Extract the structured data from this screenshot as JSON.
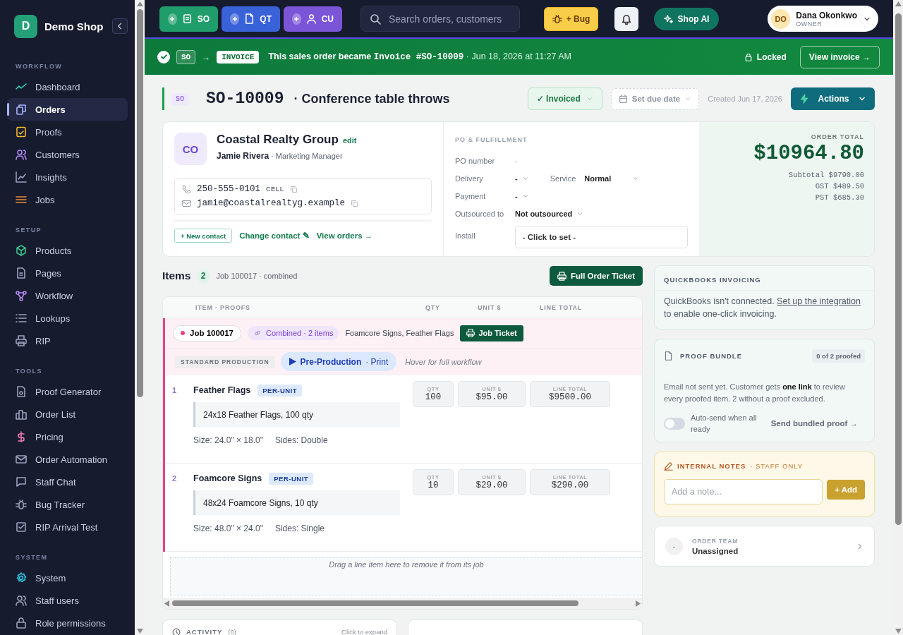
{
  "sidebar": {
    "logo_letter": "D",
    "brand": "Demo Shop",
    "sections": [
      {
        "title": "WORKFLOW",
        "items": [
          {
            "label": "Dashboard",
            "selected": false
          },
          {
            "label": "Orders",
            "selected": true
          },
          {
            "label": "Proofs",
            "selected": false
          },
          {
            "label": "Customers",
            "selected": false
          },
          {
            "label": "Insights",
            "selected": false
          },
          {
            "label": "Jobs",
            "selected": false
          }
        ]
      },
      {
        "title": "SETUP",
        "items": [
          {
            "label": "Products",
            "selected": false
          },
          {
            "label": "Pages",
            "selected": false
          },
          {
            "label": "Workflow",
            "selected": false
          },
          {
            "label": "Lookups",
            "selected": false
          },
          {
            "label": "RIP",
            "selected": false
          }
        ]
      },
      {
        "title": "TOOLS",
        "items": [
          {
            "label": "Proof Generator",
            "selected": false
          },
          {
            "label": "Order List",
            "selected": false
          },
          {
            "label": "Pricing",
            "selected": false
          },
          {
            "label": "Order Automation",
            "selected": false
          },
          {
            "label": "Staff Chat",
            "selected": false
          },
          {
            "label": "Bug Tracker",
            "selected": false
          },
          {
            "label": "RIP Arrival Test",
            "selected": false
          }
        ]
      },
      {
        "title": "SYSTEM",
        "items": [
          {
            "label": "System",
            "selected": false
          },
          {
            "label": "Staff users",
            "selected": false
          },
          {
            "label": "Role permissions",
            "selected": false
          }
        ]
      }
    ]
  },
  "topbar": {
    "quick_create": [
      {
        "label": "SO",
        "color": "#1f9d6a"
      },
      {
        "label": "QT",
        "color": "#3a62d8"
      },
      {
        "label": "CU",
        "color": "#7b55d8"
      }
    ],
    "search": {
      "placeholder": "Search orders, customers"
    },
    "bug_button": "+ Bug",
    "ai_button": "Shop AI",
    "user": {
      "initials": "DO",
      "name": "Dana Okonkwo",
      "role": "OWNER"
    }
  },
  "banner": {
    "from": "SO",
    "arrow": "→",
    "to": "INVOICE",
    "message_start": "This sales order became ",
    "invoice_ref": "Invoice #SO-10009",
    "message_end": " · Jun 18, 2026 at 11:27 AM",
    "locked": "Locked",
    "button": "View invoice →"
  },
  "header": {
    "badge": "SO",
    "number": "SO-10009",
    "title": "· Conference table throws",
    "status": "✓ Invoiced",
    "due_date": "Set due date",
    "created": "Created Jun 17, 2026",
    "actions": "Actions"
  },
  "customer": {
    "initials": "CO",
    "name": "Coastal Realty Group",
    "edit": "edit",
    "contact_name": "Jamie Rivera",
    "contact_role": "· Marketing Manager",
    "phone": "250-555-0101",
    "phone_type": "CELL",
    "email": "jamie@coastalrealtyg.example",
    "new_contact": "+ New contact",
    "change_contact": "Change contact ✎",
    "view_orders": "View orders →"
  },
  "po": {
    "title": "PO & FULFILLMENT",
    "fields": [
      {
        "kind": "text",
        "label": "PO number",
        "value": "-"
      },
      {
        "kind": "select",
        "label": "Delivery",
        "value": "-",
        "extra_label": "Service",
        "extra_value": "Normal"
      },
      {
        "kind": "select",
        "label": "Payment",
        "value": "-"
      },
      {
        "kind": "select",
        "label": "Outsourced to",
        "value": "Not outsourced"
      },
      {
        "kind": "input",
        "label": "Install",
        "value": "- Click to set -"
      }
    ]
  },
  "total": {
    "label": "ORDER TOTAL",
    "amount": "$10964.80",
    "lines": [
      {
        "label": "Subtotal",
        "value": "$9790.00"
      },
      {
        "label": "GST",
        "value": "$489.50"
      },
      {
        "label": "PST",
        "value": "$685.30"
      }
    ]
  },
  "items": {
    "title": "Items",
    "count": "2",
    "note": "Job 100017 · combined",
    "ticket_button": "Full Order Ticket",
    "columns": [
      "ITEM · PROOFS",
      "QTY",
      "UNIT $",
      "LINE TOTAL"
    ],
    "job": {
      "label": "Job 100017",
      "combined": "Combined · 2 items",
      "names": "Foamcore Signs, Feather Flags",
      "ticket": "Job Ticket",
      "production": "STANDARD PRODUCTION",
      "stage": "Pre-Production",
      "stage_sub": "· Print",
      "hint": "Hover for full workflow"
    },
    "lines": [
      {
        "number": "1",
        "name": "Feather Flags",
        "pricing": "PER-UNIT",
        "description": "24x18 Feather Flags, 100 qty",
        "size": "Size: 24.0\" × 18.0\"",
        "sides": "Sides: Double",
        "qty_label": "QTY",
        "qty": "100",
        "unit_label": "UNIT $",
        "unit": "$95.00",
        "total_label": "LINE TOTAL",
        "total": "$9500.00"
      },
      {
        "number": "2",
        "name": "Foamcore Signs",
        "pricing": "PER-UNIT",
        "description": "48x24 Foamcore Signs, 10 qty",
        "size": "Size: 48.0\" × 24.0\"",
        "sides": "Sides: Single",
        "qty_label": "QTY",
        "qty": "10",
        "unit_label": "UNIT $",
        "unit": "$29.00",
        "total_label": "LINE TOTAL",
        "total": "$290.00"
      }
    ],
    "drop_hint": "Drag a line item here to remove it from its job"
  },
  "quickbooks": {
    "title": "QUICKBOOKS INVOICING",
    "text_start": "QuickBooks isn't connected. ",
    "link": "Set up the integration",
    "text_end": " to enable one-click invoicing."
  },
  "proof_bundle": {
    "title": "PROOF BUNDLE",
    "count": "0 of 2 proofed",
    "text": "Email not sent yet. Customer gets **one link** to review every proofed item. 2 without a proof excluded.",
    "toggle": {
      "label": "Auto-send when all ready",
      "on": false
    },
    "action": "Send bundled proof →"
  },
  "notes": {
    "title": "INTERNAL NOTES",
    "subtitle": "· STAFF ONLY",
    "placeholder": "Add a note...",
    "button": "+ Add"
  },
  "team": {
    "avatar": "-",
    "label": "ORDER TEAM",
    "value": "Unassigned"
  },
  "activity": {
    "title": "ACTIVITY",
    "count": "(0)",
    "action": "Click to expand"
  }
}
